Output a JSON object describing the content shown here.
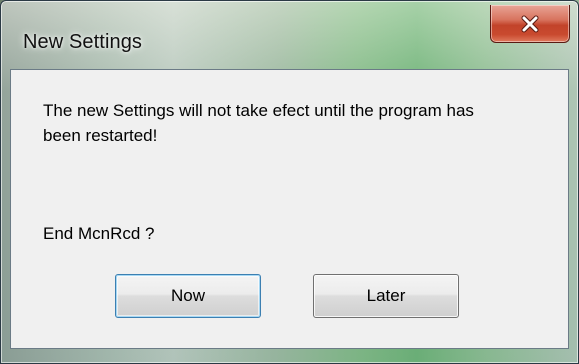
{
  "window": {
    "title": "New Settings",
    "close_icon": "close-icon"
  },
  "dialog": {
    "message": "The new Settings will not take efect until the program has been restarted!",
    "question": "End McnRcd ?",
    "buttons": {
      "now_label": "Now",
      "later_label": "Later"
    }
  },
  "colors": {
    "close_button": "#c94a2f",
    "client_background": "#f0f0f0",
    "default_button_border": "#3c7fb1"
  }
}
